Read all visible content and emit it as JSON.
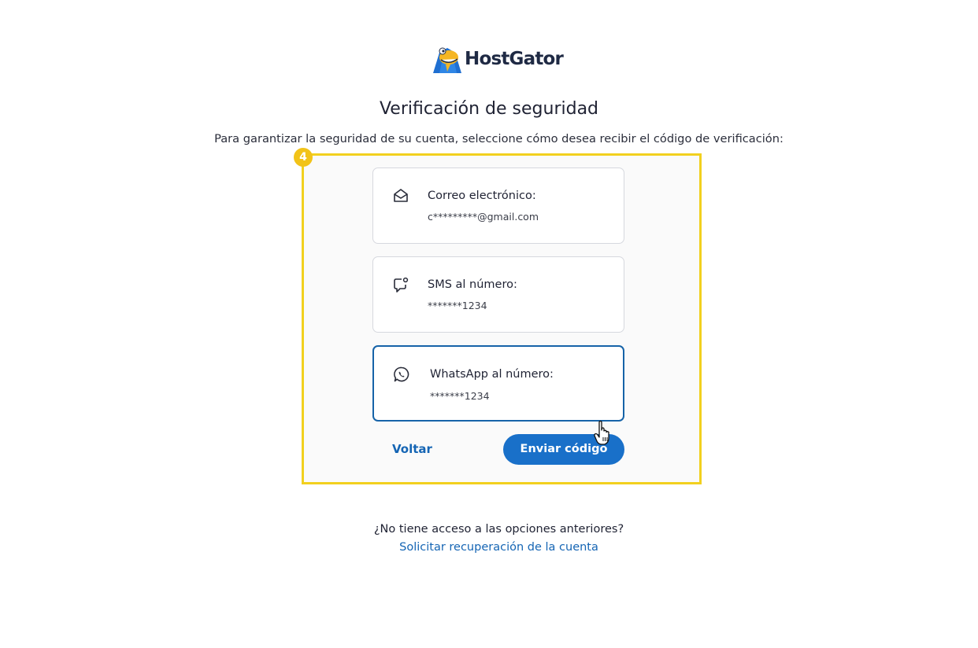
{
  "brand": {
    "name": "HostGator",
    "logo_icon": "gator-mascot-icon"
  },
  "page": {
    "title": "Verificación de seguridad",
    "subtitle": "Para garantizar la seguridad de su cuenta, seleccione cómo desea recibir el código de verificación:"
  },
  "step_badge": "4",
  "options": [
    {
      "icon": "envelope-icon",
      "label": "Correo electrónico:",
      "value": "c*********@gmail.com",
      "selected": false
    },
    {
      "icon": "sms-chat-icon",
      "label": "SMS al número:",
      "value": "*******1234",
      "selected": false
    },
    {
      "icon": "whatsapp-icon",
      "label": "WhatsApp al número:",
      "value": "*******1234",
      "selected": true
    }
  ],
  "actions": {
    "back_label": "Voltar",
    "send_label": "Enviar código"
  },
  "footer": {
    "question": "¿No tiene acceso a las opciones anteriores?",
    "recover_link": "Solicitar recuperación de la cuenta"
  },
  "colors": {
    "accent": "#1970c9",
    "link": "#1565b4",
    "highlight": "#f2d01e",
    "badge": "#f2c318",
    "selected_border": "#1663a8"
  }
}
